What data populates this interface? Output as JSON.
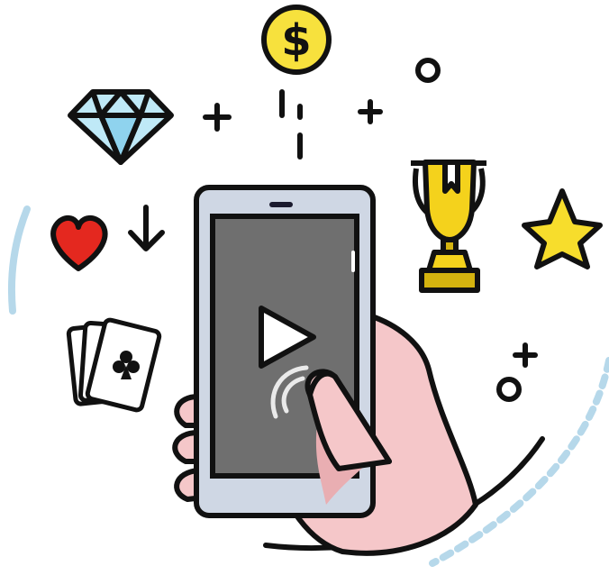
{
  "illustration": {
    "coin_symbol": "$",
    "colors": {
      "outline": "#111111",
      "diamond": "#bfe9f7",
      "diamond_dark": "#8fd3ee",
      "coin": "#f7e13d",
      "heart": "#e4281f",
      "trophy": "#f4d21c",
      "trophy_dark": "#d4b30f",
      "star": "#f7dd2c",
      "phone_body": "#cfd7e4",
      "screen": "#6f6f6f",
      "skin": "#f5c7c9",
      "skin_shadow": "#e9aeb2",
      "arc_light": "#b6d8ea",
      "card": "#ffffff",
      "ripple": "#eaeaea"
    },
    "icons": [
      "diamond-icon",
      "dollar-coin-icon",
      "trophy-icon",
      "star-icon",
      "heart-icon",
      "playing-cards-icon",
      "down-arrow-icon",
      "play-icon",
      "smartphone",
      "hand"
    ]
  }
}
